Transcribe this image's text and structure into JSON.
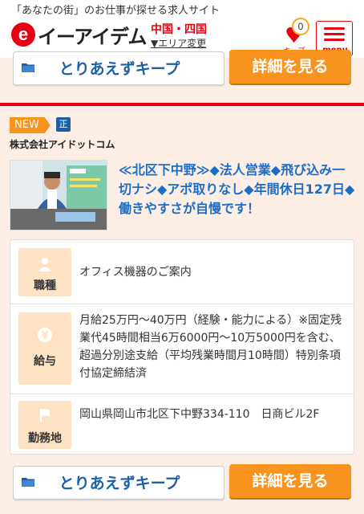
{
  "header": {
    "tagline": "「あなたの街」のお仕事が探せる求人サイト",
    "logo_text": "イーアイデム",
    "region": "中国・四国",
    "area_change": "▼エリア変更",
    "keep_count": "0",
    "keep_label": "キープ",
    "menu_label": "menu"
  },
  "actions": {
    "keep_label": "とりあえずキープ",
    "detail_label": "詳細を見る"
  },
  "job": {
    "new_badge": "NEW",
    "type_badge": "正",
    "company": "株式会社アイドットコム",
    "title": "≪北区下中野≫◆法人営業◆飛び込み一切ナシ◆アポ取りなし◆年間休日127日◆働きやすさが自慢です！",
    "details": [
      {
        "label": "職種",
        "icon": "person-icon",
        "value": "オフィス機器のご案内"
      },
      {
        "label": "給与",
        "icon": "yen-icon",
        "value": "月給25万円〜40万円（経験・能力による）※固定残業代45時間相当6万6000円〜10万5000円を含む、超過分別途支給（平均残業時間月10時間）特別条項付協定締結済"
      },
      {
        "label": "勤務地",
        "icon": "flag-icon",
        "value": "岡山県岡山市北区下中野334-110　日商ビル2F"
      }
    ]
  },
  "colors": {
    "brand_red": "#e60012",
    "accent_orange": "#f7931e",
    "link_blue": "#1a6ec7",
    "background": "#fdeee5"
  }
}
